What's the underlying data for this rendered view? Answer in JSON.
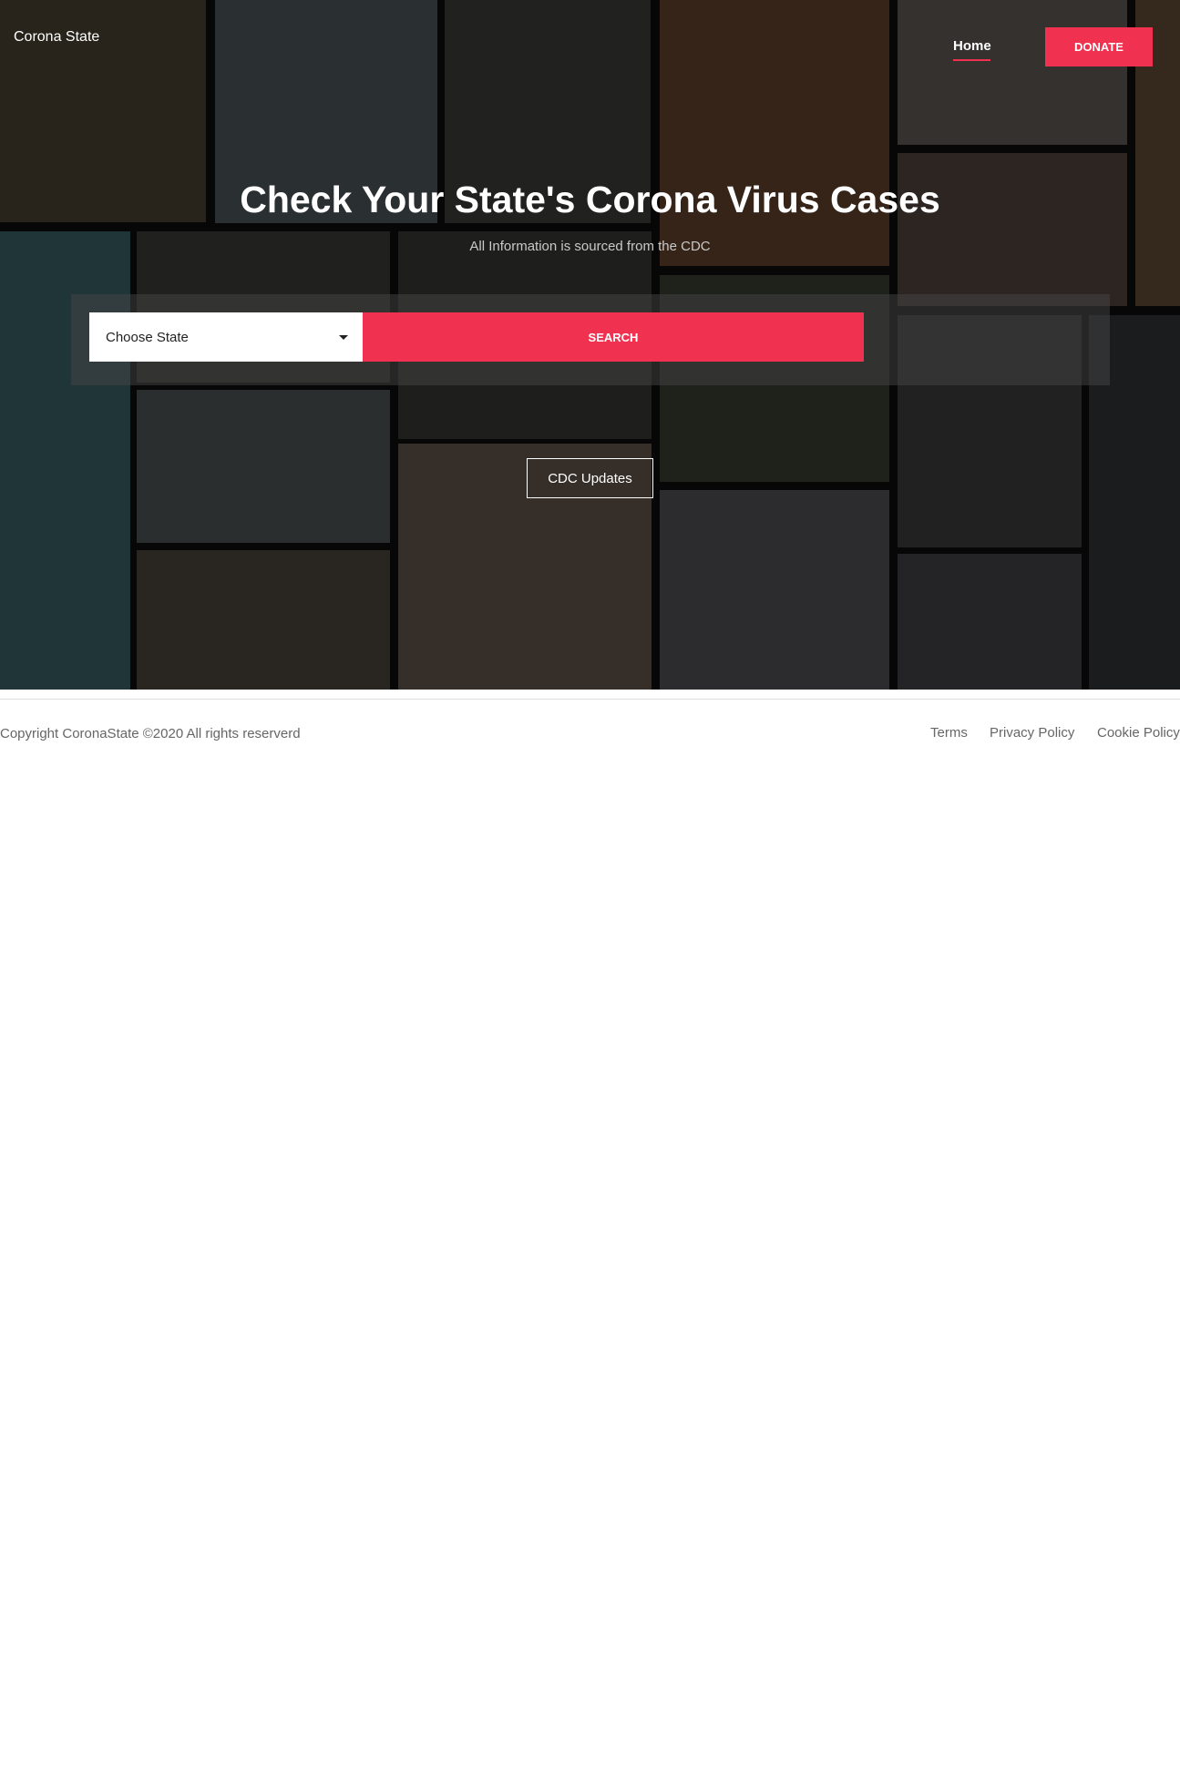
{
  "header": {
    "brand": "Corona State",
    "nav_home": "Home",
    "donate_label": "DONATE"
  },
  "hero": {
    "title": "Check Your State's Corona Virus Cases",
    "subtitle": "All Information is sourced from the CDC",
    "state_select_value": "Choose State",
    "search_label": "SEARCH",
    "cdc_updates_label": "CDC Updates"
  },
  "footer": {
    "copyright": "Copyright CoronaState ©2020 All rights reserverd",
    "links": [
      "Terms",
      "Privacy Policy",
      "Cookie Policy"
    ]
  },
  "colors": {
    "accent": "#f03150",
    "hero_overlay": "#0b0b0b",
    "footer_text": "#666666"
  },
  "icons": {
    "select_caret": "chevron-down-icon"
  }
}
